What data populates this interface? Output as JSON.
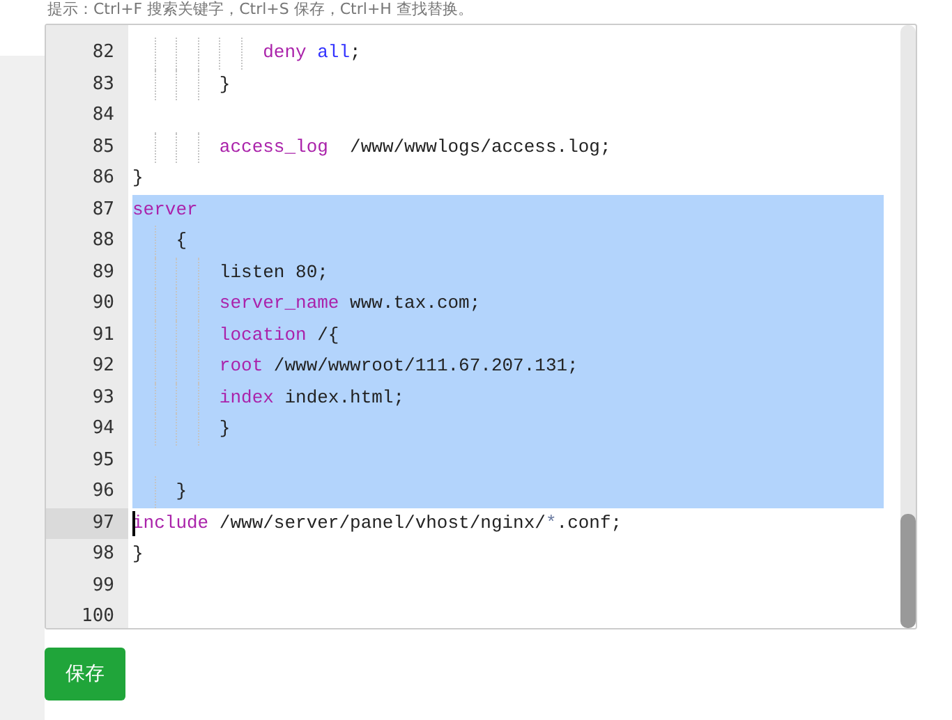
{
  "hint": "提示：Ctrl+F 搜索关键字，Ctrl+S 保存，Ctrl+H 查找替换。",
  "editor": {
    "lines": [
      {
        "number": "82",
        "selected": false,
        "active": false,
        "tokens": [
          {
            "text": "            deny",
            "kind": "keyword"
          },
          {
            "text": " all",
            "kind": "atom"
          },
          {
            "text": ";",
            "kind": "plain"
          }
        ]
      },
      {
        "number": "83",
        "selected": false,
        "active": false,
        "tokens": [
          {
            "text": "        }",
            "kind": "plain"
          }
        ]
      },
      {
        "number": "84",
        "selected": false,
        "active": false
      },
      {
        "number": "85",
        "selected": false,
        "active": false,
        "tokens": [
          {
            "text": "        access_log",
            "kind": "keyword"
          },
          {
            "text": "  /www/wwwlogs/access.log;",
            "kind": "plain"
          }
        ]
      },
      {
        "number": "86",
        "selected": false,
        "active": false,
        "tokens": [
          {
            "text": "}",
            "kind": "plain"
          }
        ]
      },
      {
        "number": "87",
        "selected": true,
        "active": false,
        "tokens": [
          {
            "text": "server",
            "kind": "keyword"
          }
        ]
      },
      {
        "number": "88",
        "selected": true,
        "active": false,
        "tokens": [
          {
            "text": "    {",
            "kind": "plain"
          }
        ]
      },
      {
        "number": "89",
        "selected": true,
        "active": false,
        "tokens": [
          {
            "text": "        listen 80;",
            "kind": "plain"
          }
        ]
      },
      {
        "number": "90",
        "selected": true,
        "active": false,
        "tokens": [
          {
            "text": "        server_name",
            "kind": "keyword"
          },
          {
            "text": " www.tax.com;",
            "kind": "plain"
          }
        ]
      },
      {
        "number": "91",
        "selected": true,
        "active": false,
        "tokens": [
          {
            "text": "        location",
            "kind": "keyword"
          },
          {
            "text": " /{",
            "kind": "plain"
          }
        ]
      },
      {
        "number": "92",
        "selected": true,
        "active": false,
        "tokens": [
          {
            "text": "        root",
            "kind": "keyword"
          },
          {
            "text": " /www/wwwroot/111.67.207.131;",
            "kind": "plain"
          }
        ]
      },
      {
        "number": "93",
        "selected": true,
        "active": false,
        "tokens": [
          {
            "text": "        index",
            "kind": "keyword"
          },
          {
            "text": " index.html;",
            "kind": "plain"
          }
        ]
      },
      {
        "number": "94",
        "selected": true,
        "active": false,
        "tokens": [
          {
            "text": "        }",
            "kind": "plain"
          }
        ]
      },
      {
        "number": "95",
        "selected": true,
        "active": false
      },
      {
        "number": "96",
        "selected": true,
        "active": false,
        "tokens": [
          {
            "text": "    }",
            "kind": "plain"
          }
        ]
      },
      {
        "number": "97",
        "selected": false,
        "active": true,
        "tokens": [
          {
            "text": "include",
            "kind": "keyword"
          },
          {
            "text": " /www/server/panel/vhost/nginx/",
            "kind": "plain"
          },
          {
            "text": "*",
            "kind": "operator"
          },
          {
            "text": ".conf;",
            "kind": "plain"
          }
        ]
      },
      {
        "number": "98",
        "selected": false,
        "active": false,
        "tokens": [
          {
            "text": "}",
            "kind": "plain"
          }
        ]
      },
      {
        "number": "99",
        "selected": false,
        "active": false
      },
      {
        "number": "100",
        "selected": false,
        "active": false
      }
    ]
  },
  "save_button": "保存"
}
